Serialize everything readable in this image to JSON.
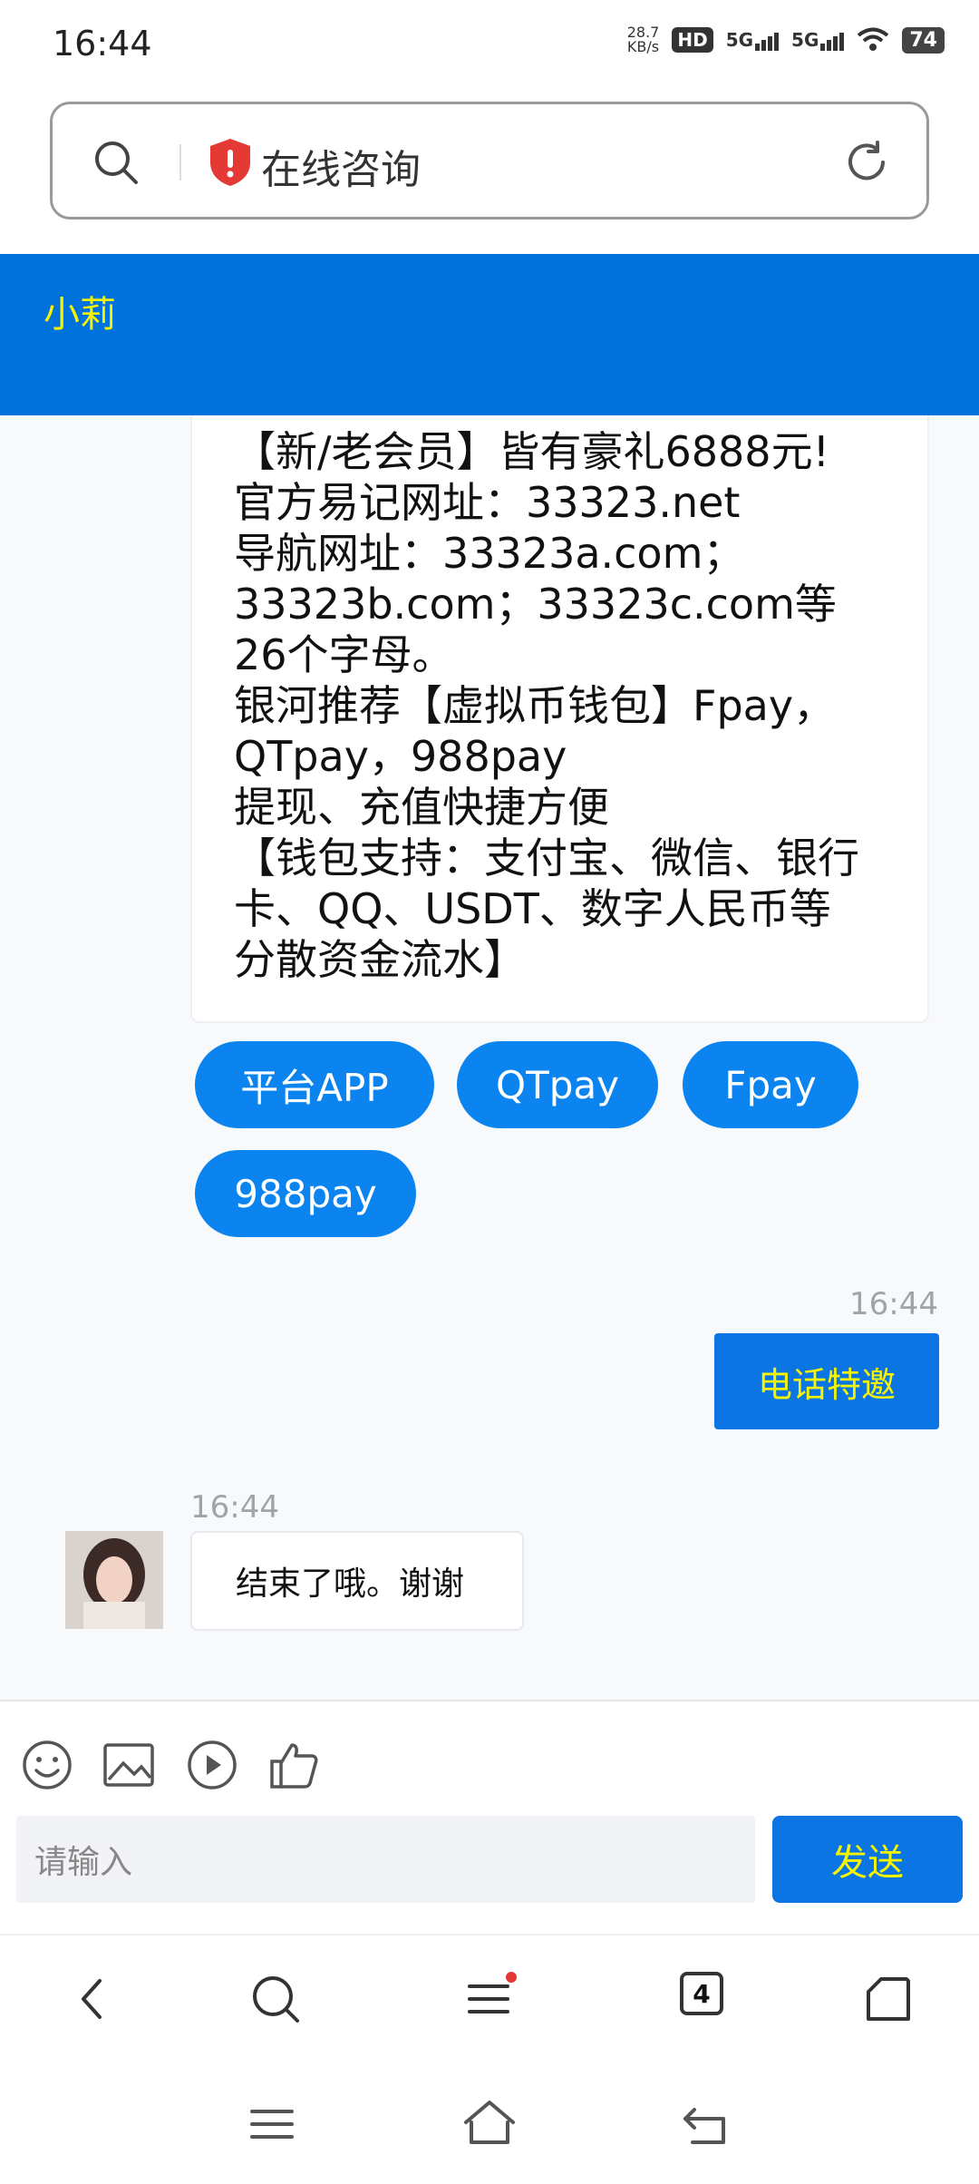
{
  "status": {
    "time": "16:44",
    "speed_value": "28.7",
    "speed_unit": "KB/s",
    "hd": "HD",
    "signal1": "5G",
    "signal2": "5G",
    "battery": "74"
  },
  "url_bar": {
    "title": "在线咨询"
  },
  "header": {
    "title": "小莉"
  },
  "messages": {
    "card_lines": [
      "【新/老会员】皆有豪礼6888元!",
      "官方易记网址：33323.net",
      "导航网址：33323a.com；",
      "33323b.com；33323c.com等",
      "26个字母。",
      "银河推荐【虚拟币钱包】Fpay，",
      "QTpay，988pay",
      "提现、充值快捷方便",
      "【钱包支持：支付宝、微信、银行",
      "卡、QQ、USDT、数字人民币等",
      "分散资金流水】"
    ],
    "chips": [
      "平台APP",
      "QTpay",
      "Fpay",
      "988pay"
    ],
    "right_time": "16:44",
    "right_text": "电话特邀",
    "left_time": "16:44",
    "left_text": "结束了哦。谢谢"
  },
  "composer": {
    "placeholder": "请输入",
    "send_label": "发送"
  },
  "browser_nav": {
    "tabs_count": "4"
  },
  "colors": {
    "header_blue": "#0072dc",
    "chip_blue": "#0b84ef",
    "accent_yellow": "#f7f400"
  }
}
